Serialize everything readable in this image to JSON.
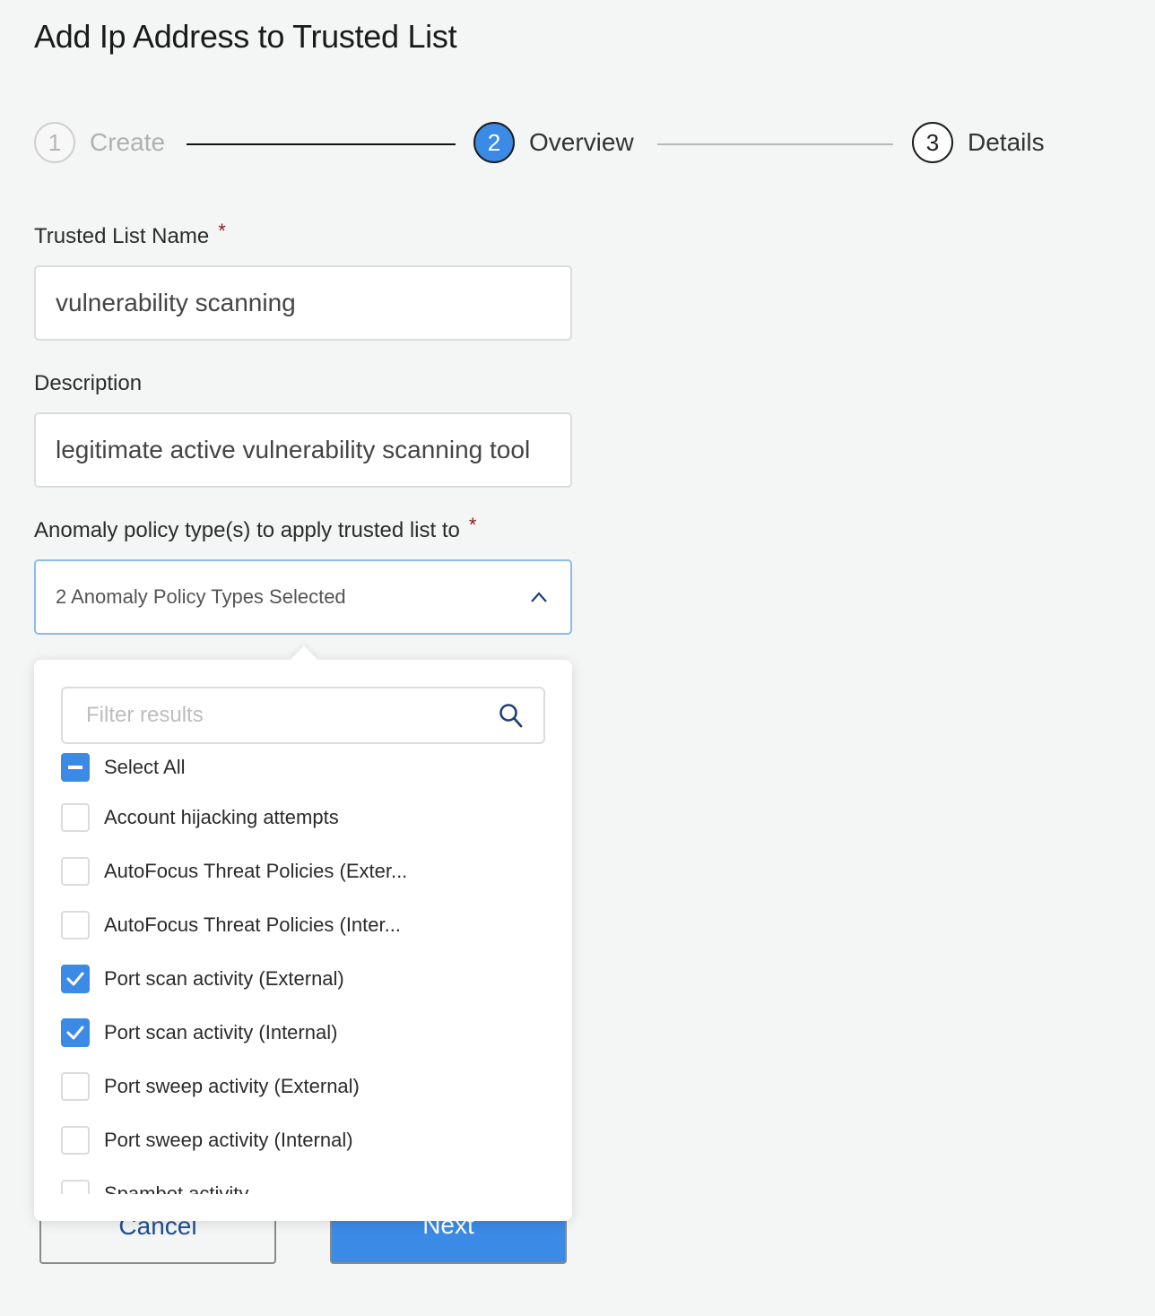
{
  "page": {
    "title": "Add Ip Address to Trusted List"
  },
  "stepper": {
    "steps": [
      {
        "number": "1",
        "label": "Create",
        "state": "completed"
      },
      {
        "number": "2",
        "label": "Overview",
        "state": "active"
      },
      {
        "number": "3",
        "label": "Details",
        "state": "upcoming"
      }
    ]
  },
  "form": {
    "name": {
      "label": "Trusted List Name",
      "required_mark": "*",
      "value": "vulnerability scanning"
    },
    "description": {
      "label": "Description",
      "value": "legitimate active vulnerability scanning tool"
    },
    "policy_types": {
      "label": "Anomaly policy type(s) to apply trusted list to",
      "required_mark": "*",
      "summary": "2 Anomaly Policy Types Selected",
      "expanded": true
    }
  },
  "dropdown": {
    "filter_placeholder": "Filter results",
    "filter_value": "",
    "select_all": {
      "label": "Select All",
      "state": "indeterminate"
    },
    "options": [
      {
        "label": "Account hijacking attempts",
        "checked": false
      },
      {
        "label": "AutoFocus Threat Policies (Exter...",
        "checked": false
      },
      {
        "label": "AutoFocus Threat Policies (Inter...",
        "checked": false
      },
      {
        "label": "Port scan activity (External)",
        "checked": true
      },
      {
        "label": "Port scan activity (Internal)",
        "checked": true
      },
      {
        "label": "Port sweep activity (External)",
        "checked": false
      },
      {
        "label": "Port sweep activity (Internal)",
        "checked": false
      },
      {
        "label": "Spambot activity",
        "checked": false
      }
    ]
  },
  "actions": {
    "cancel_label": "Cancel",
    "next_label": "Next"
  },
  "colors": {
    "accent": "#3b8ae6",
    "required": "#8b1a1a",
    "link_text": "#1f4f8f"
  }
}
